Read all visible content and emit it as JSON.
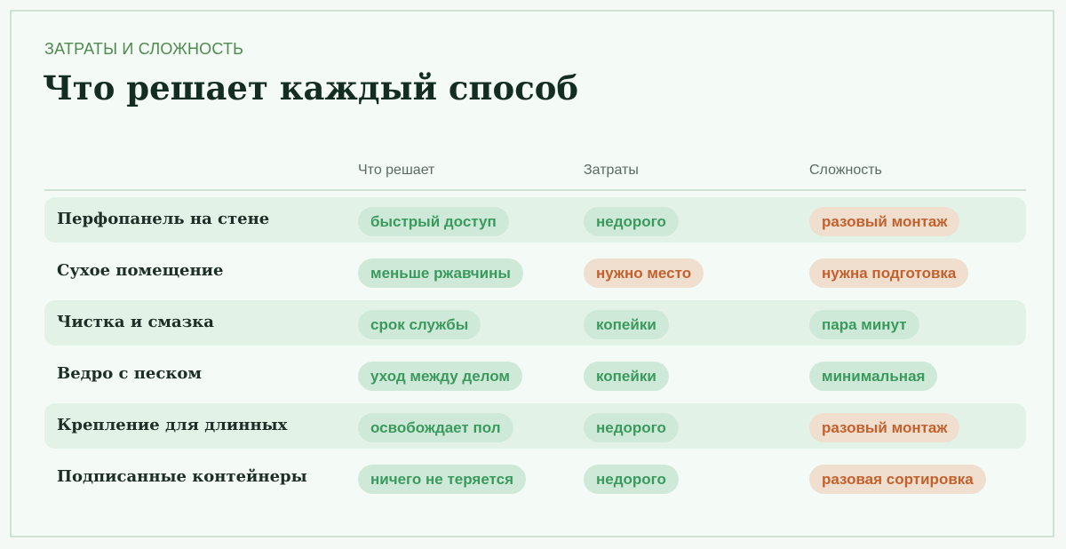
{
  "header": {
    "eyebrow": "ЗАТРАТЫ И СЛОЖНОСТЬ",
    "title": "Что решает каждый способ"
  },
  "columns": [
    "Что решает",
    "Затраты",
    "Сложность"
  ],
  "rows": [
    {
      "label": "Перфопанель на стене",
      "solves": {
        "text": "быстрый доступ",
        "tone": "good"
      },
      "cost": {
        "text": "недорого",
        "tone": "good"
      },
      "complexity": {
        "text": "разовый монтаж",
        "tone": "warn"
      }
    },
    {
      "label": "Сухое помещение",
      "solves": {
        "text": "меньше ржавчины",
        "tone": "good"
      },
      "cost": {
        "text": "нужно место",
        "tone": "warn"
      },
      "complexity": {
        "text": "нужна подготовка",
        "tone": "warn"
      }
    },
    {
      "label": "Чистка и смазка",
      "solves": {
        "text": "срок службы",
        "tone": "good"
      },
      "cost": {
        "text": "копейки",
        "tone": "good"
      },
      "complexity": {
        "text": "пара минут",
        "tone": "good"
      }
    },
    {
      "label": "Ведро с песком",
      "solves": {
        "text": "уход между делом",
        "tone": "good"
      },
      "cost": {
        "text": "копейки",
        "tone": "good"
      },
      "complexity": {
        "text": "минимальная",
        "tone": "good"
      }
    },
    {
      "label": "Крепление для длинных",
      "solves": {
        "text": "освобождает пол",
        "tone": "good"
      },
      "cost": {
        "text": "недорого",
        "tone": "good"
      },
      "complexity": {
        "text": "разовый монтаж",
        "tone": "warn"
      }
    },
    {
      "label": "Подписанные контейнеры",
      "solves": {
        "text": "ничего не теряется",
        "tone": "good"
      },
      "cost": {
        "text": "недорого",
        "tone": "good"
      },
      "complexity": {
        "text": "разовая сортировка",
        "tone": "warn"
      }
    }
  ],
  "colors": {
    "good_bg": "#cfe9d8",
    "good_text": "#3a9a5d",
    "warn_bg": "#f0dfcf",
    "warn_text": "#c3612d",
    "row_shade": "#e3f2e7"
  }
}
